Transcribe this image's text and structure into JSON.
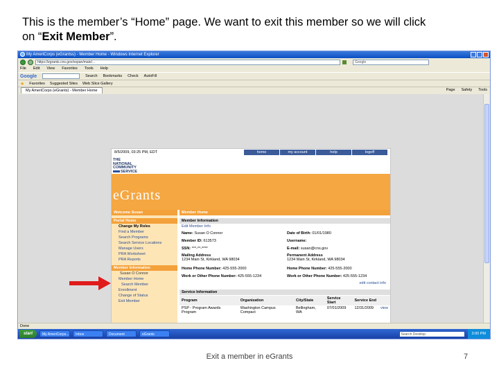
{
  "caption": {
    "line1": "This is the member’s “Home” page. We want to exit this member so we will click",
    "line2_prefix": "on “",
    "line2_bold": "Exit Member",
    "line2_suffix": "”."
  },
  "browser": {
    "title": "My AmeriCorps (eGrantss) - Member Home - Windows Internet Explorer",
    "address": "https://egrants.cns.gov/espan/main/...",
    "search_placeholder": "Google",
    "menu": [
      "File",
      "Edit",
      "View",
      "Favorites",
      "Tools",
      "Help"
    ],
    "toolbar": [
      "Google",
      "Search",
      "Bookmarks",
      "Check",
      "AutoFill"
    ],
    "favorites": [
      "Favorites",
      "Suggested Sites",
      "Web Slice Gallery"
    ],
    "tab_title": "My AmeriCorps (eGrants) - Member Home",
    "tab_tools": [
      "Page",
      "Safety",
      "Tools"
    ],
    "status": "Done",
    "taskbar": {
      "start": "start",
      "items": [
        "My AmeriCorps...",
        "Inbox",
        "Document",
        "eGrants"
      ],
      "search_placeholder": "Search Desktop",
      "clock": "3:00 PM"
    }
  },
  "webpage": {
    "datetime": "8/5/2009, 03:25 PM, EDT",
    "top_nav": [
      "home",
      "my account",
      "help",
      "logoff"
    ],
    "logo_lines": [
      "THE",
      "NATIONAL",
      "COMMUNITY",
      "SERVICE"
    ],
    "logo_text": "eGrants",
    "left_nav": {
      "welcome_head": "Welcome Susan",
      "portal_head": "Portal Home",
      "portal_items": [
        "Change My Roles",
        "Find a Member",
        "Search Programs",
        "Search Service Locations",
        "Manage Users",
        "PRA Worksheet",
        "PRA Reports"
      ],
      "member_head": "Member Information",
      "member_name": "Susan O Connor",
      "member_items": [
        "Member Home",
        "Search Member",
        "Enrollment",
        "Change of Status",
        "Exit Member"
      ]
    },
    "content": {
      "breadcrumb": "Member Home",
      "member_info_head": "Member Information",
      "edit_member": "Edit Member Info",
      "name_label": "Name:",
      "name_value": "Susan O Connor",
      "dob_label": "Date of Birth:",
      "dob_value": "01/01/1980",
      "member_id_label": "Member ID:",
      "member_id_value": "613573",
      "username_label": "Username:",
      "ssn_label": "SSN:",
      "ssn_value": "***-**-****",
      "email_label": "E-mail:",
      "email_value": "susan@cns.gov",
      "mailing_label": "Mailing Address",
      "mailing_value": "1234 Main St, Kirkland, WA 98034",
      "permanent_label": "Permanent Address",
      "permanent_value": "1234 Main St, Kirkland, WA 98034",
      "home_phone_label": "Home Phone Number:",
      "home_phone_value": "425-555-2000",
      "home_phone2_label": "Home Phone Number:",
      "home_phone2_value": "425-555-2000",
      "work_phone_label": "Work or Other Phone Number:",
      "work_phone_value": "425-555-1234",
      "work_phone2_label": "Work or Other Phone Number:",
      "work_phone2_value": "425-555-1234",
      "edit_contact": "edit contact info",
      "service_head": "Service Information",
      "service_columns": [
        "Program",
        "Organization",
        "City/State",
        "Service Start",
        "Service End",
        ""
      ],
      "service_rows": [
        [
          "PSP - Program Awards Program",
          "Washington Campus Compact",
          "Bellingham, WA",
          "07/01/2009",
          "12/31/2009",
          "view"
        ]
      ]
    }
  },
  "footer": {
    "text": "Exit a member in eGrants",
    "page_number": "7"
  },
  "colors": {
    "header_orange": "#f5a742",
    "nav_blue": "#3b5b99",
    "arrow_red": "#e01b1b"
  }
}
